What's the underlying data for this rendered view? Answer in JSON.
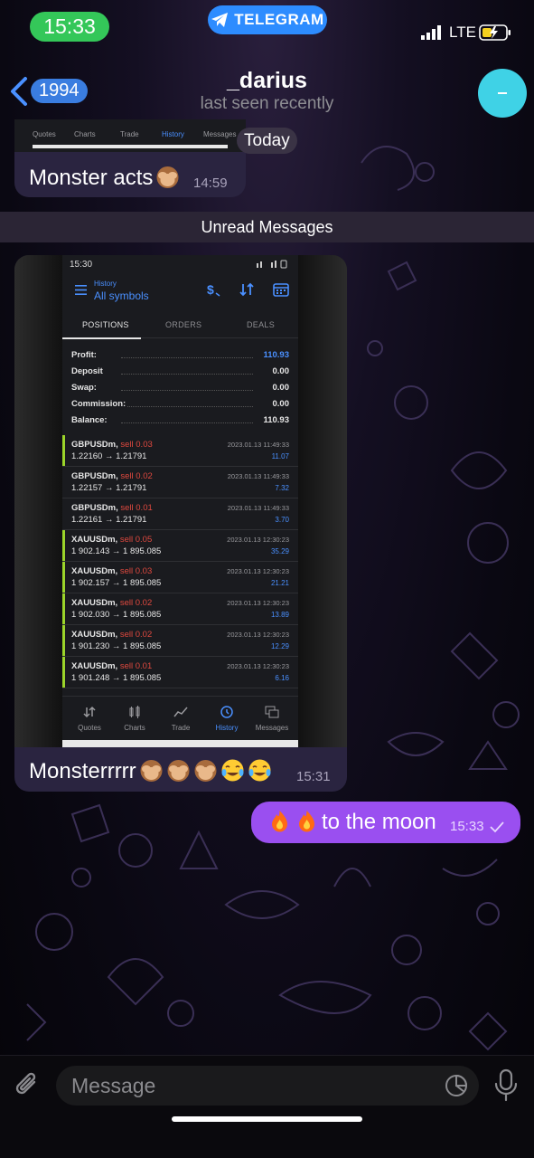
{
  "status_bar": {
    "time": "15:33",
    "app_pill": "TELEGRAM",
    "network": "LTE"
  },
  "header": {
    "back_count": "1994",
    "title": "_darius",
    "subtitle": "last seen recently"
  },
  "top_partial_nav": [
    "Quotes",
    "Charts",
    "Trade",
    "History",
    "Messages"
  ],
  "date_separator": "Today",
  "messages": [
    {
      "text": "Monster acts",
      "time": "14:59",
      "emoji": [
        "see-no-evil-monkey"
      ]
    },
    {
      "text": "Monsterrrrr",
      "time": "15:31",
      "emoji": [
        "see-no-evil-monkey",
        "see-no-evil-monkey",
        "see-no-evil-monkey",
        "tears-of-joy",
        "tears-of-joy"
      ]
    },
    {
      "text": "to the moon",
      "time": "15:33",
      "emoji": [
        "fire",
        "fire"
      ],
      "read": true
    }
  ],
  "unread_label": "Unread Messages",
  "screenshot": {
    "time": "15:30",
    "header_small": "History",
    "header": "All symbols",
    "tabs": [
      "POSITIONS",
      "ORDERS",
      "DEALS"
    ],
    "summary": [
      {
        "label": "Profit:",
        "value": "110.93"
      },
      {
        "label": "Deposit",
        "value": "0.00"
      },
      {
        "label": "Swap:",
        "value": "0.00"
      },
      {
        "label": "Commission:",
        "value": "0.00"
      },
      {
        "label": "Balance:",
        "value": "110.93"
      }
    ],
    "trades": [
      {
        "symbol": "GBPUSDm,",
        "side": "sell 0.03",
        "prices": "1.22160 → 1.21791",
        "datetime": "2023.01.13 11:49:33",
        "profit": "11.07"
      },
      {
        "symbol": "GBPUSDm,",
        "side": "sell 0.02",
        "prices": "1.22157 → 1.21791",
        "datetime": "2023.01.13 11:49:33",
        "profit": "7.32"
      },
      {
        "symbol": "GBPUSDm,",
        "side": "sell 0.01",
        "prices": "1.22161 → 1.21791",
        "datetime": "2023.01.13 11:49:33",
        "profit": "3.70"
      },
      {
        "symbol": "XAUUSDm,",
        "side": "sell 0.05",
        "prices": "1 902.143 → 1 895.085",
        "datetime": "2023.01.13 12:30:23",
        "profit": "35.29"
      },
      {
        "symbol": "XAUUSDm,",
        "side": "sell 0.03",
        "prices": "1 902.157 → 1 895.085",
        "datetime": "2023.01.13 12:30:23",
        "profit": "21.21"
      },
      {
        "symbol": "XAUUSDm,",
        "side": "sell 0.02",
        "prices": "1 902.030 → 1 895.085",
        "datetime": "2023.01.13 12:30:23",
        "profit": "13.89"
      },
      {
        "symbol": "XAUUSDm,",
        "side": "sell 0.02",
        "prices": "1 901.230 → 1 895.085",
        "datetime": "2023.01.13 12:30:23",
        "profit": "12.29"
      },
      {
        "symbol": "XAUUSDm,",
        "side": "sell 0.01",
        "prices": "1 901.248 → 1 895.085",
        "datetime": "2023.01.13 12:30:23",
        "profit": "6.16"
      }
    ],
    "nav": [
      "Quotes",
      "Charts",
      "Trade",
      "History",
      "Messages"
    ]
  },
  "input": {
    "placeholder": "Message"
  },
  "colors": {
    "outgoing_bubble": "#9a4ff0",
    "incoming_bubble": "#2a2440",
    "accent": "#2d8cff",
    "time_pill": "#34c759",
    "avatar": "#3fd2e6"
  }
}
